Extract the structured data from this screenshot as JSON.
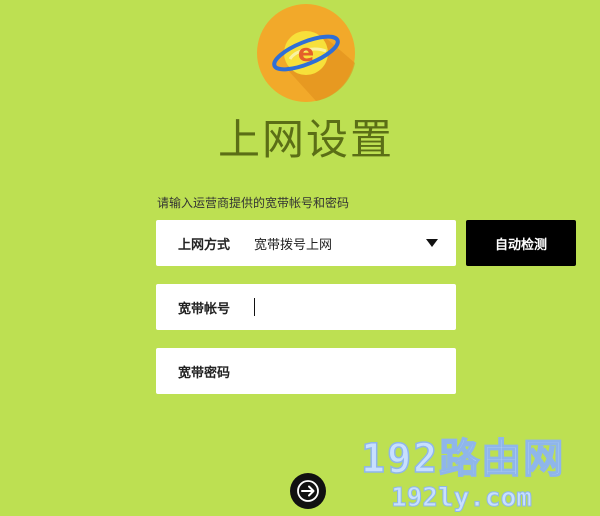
{
  "page": {
    "title": "上网设置",
    "hint": "请输入运营商提供的宽带帐号和密码"
  },
  "connection": {
    "label": "上网方式",
    "selected": "宽带拨号上网"
  },
  "detect_button": {
    "label": "自动检测"
  },
  "account": {
    "label": "宽带帐号",
    "value": ""
  },
  "password": {
    "label": "宽带密码",
    "value": ""
  },
  "icons": {
    "logo": "globe-e-logo-icon",
    "next": "arrow-right-icon",
    "dropdown": "caret-down-icon"
  },
  "watermark": {
    "main": "192路由网",
    "sub": "192ly.com"
  },
  "colors": {
    "background": "#bde052",
    "title": "#5b6e16",
    "logo_circle": "#f2a92a",
    "button": "#000000"
  }
}
